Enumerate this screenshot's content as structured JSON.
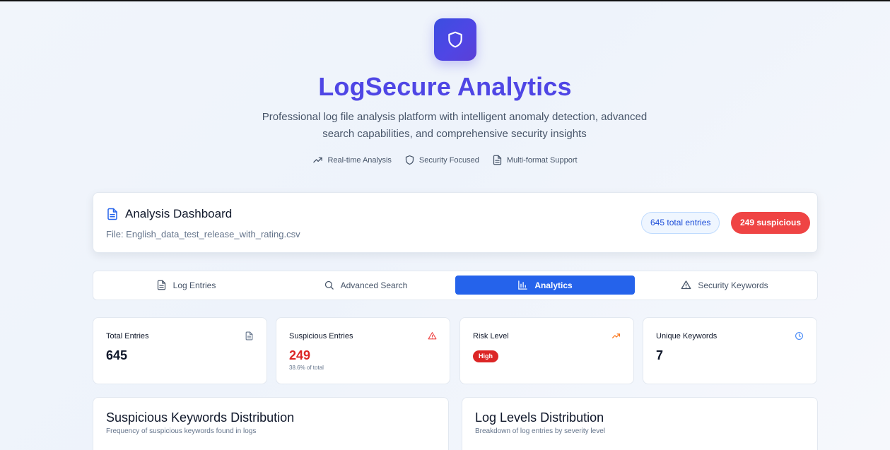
{
  "header": {
    "logo_icon": "shield-icon",
    "title": "LogSecure Analytics",
    "subtitle": "Professional log file analysis platform with intelligent anomaly detection, advanced search capabilities, and comprehensive security insights",
    "features": [
      {
        "icon": "trending-up-icon",
        "label": "Real-time Analysis"
      },
      {
        "icon": "shield-icon",
        "label": "Security Focused"
      },
      {
        "icon": "file-text-icon",
        "label": "Multi-format Support"
      }
    ]
  },
  "dashboard": {
    "title": "Analysis Dashboard",
    "file": "File: English_data_test_release_with_rating.csv",
    "total_badge": "645 total entries",
    "suspicious_badge": "249 suspicious"
  },
  "tabs": [
    {
      "label": "Log Entries",
      "icon": "file-text-icon",
      "active": false
    },
    {
      "label": "Advanced Search",
      "icon": "search-icon",
      "active": false
    },
    {
      "label": "Analytics",
      "icon": "bar-chart-icon",
      "active": true
    },
    {
      "label": "Security Keywords",
      "icon": "alert-triangle-icon",
      "active": false
    }
  ],
  "stats": {
    "total": {
      "label": "Total Entries",
      "value": "645",
      "icon": "file-text-icon"
    },
    "suspicious": {
      "label": "Suspicious Entries",
      "value": "249",
      "sub": "38.6% of total",
      "icon": "alert-triangle-icon"
    },
    "risk": {
      "label": "Risk Level",
      "badge": "High",
      "icon": "trending-up-icon"
    },
    "keywords": {
      "label": "Unique Keywords",
      "value": "7",
      "icon": "clock-icon"
    }
  },
  "charts": {
    "keywords": {
      "title": "Suspicious Keywords Distribution",
      "subtitle": "Frequency of suspicious keywords found in logs"
    },
    "levels": {
      "title": "Log Levels Distribution",
      "subtitle": "Breakdown of log entries by severity level"
    }
  },
  "colors": {
    "brand": "#4f46e5",
    "active_tab": "#2563eb",
    "danger": "#ef4444",
    "suspicious_value": "#dc2626",
    "trend": "#f97316",
    "info": "#3b82f6"
  }
}
